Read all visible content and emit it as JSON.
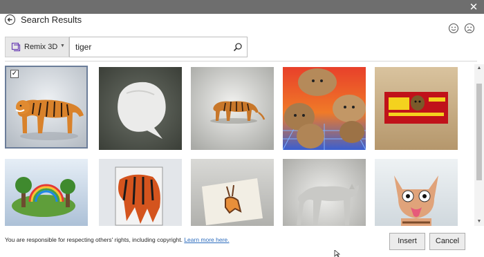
{
  "window": {
    "close_glyph": "✕"
  },
  "header": {
    "title": "Search Results"
  },
  "source": {
    "label": "Remix 3D",
    "icon": "remix-3d-icon"
  },
  "search": {
    "value": "tiger",
    "icon": "search-icon"
  },
  "feedback": {
    "happy_icon": "smile-icon",
    "sad_icon": "frown-icon"
  },
  "results": [
    {
      "name": "tiger-standing",
      "selected": true
    },
    {
      "name": "white-blob",
      "selected": false
    },
    {
      "name": "tiger-walking",
      "selected": false
    },
    {
      "name": "cat-faces-collage",
      "selected": false
    },
    {
      "name": "tiger-sign-board",
      "selected": false
    },
    {
      "name": "rainbow-diorama",
      "selected": false
    },
    {
      "name": "tiger-card",
      "selected": false
    },
    {
      "name": "rabbit-card",
      "selected": false
    },
    {
      "name": "grey-cat-model",
      "selected": false
    },
    {
      "name": "cartoon-cat",
      "selected": false
    }
  ],
  "footer": {
    "notice": "You are responsible for respecting others' rights, including copyright.",
    "link": "Learn more here."
  },
  "buttons": {
    "insert": "Insert",
    "cancel": "Cancel"
  },
  "colors": {
    "titlebar": "#6e6e6e",
    "selection_border": "#6b7d99",
    "link": "#2b6bbd"
  }
}
